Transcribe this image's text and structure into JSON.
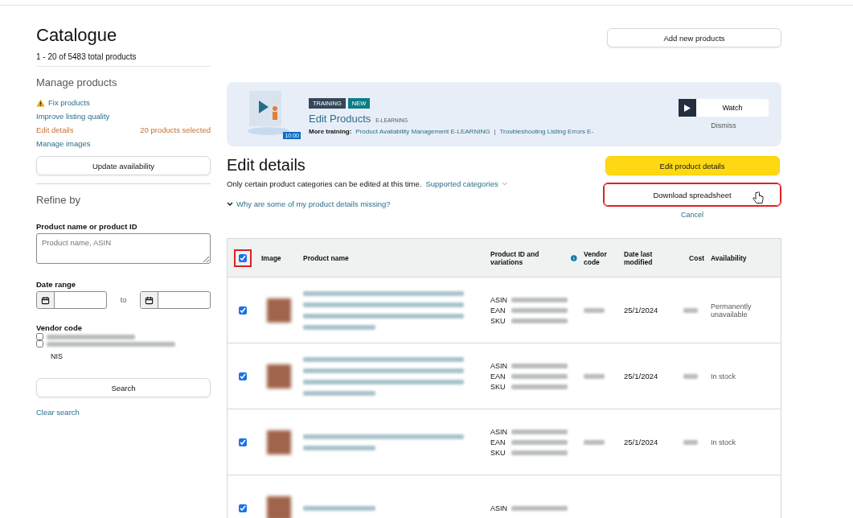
{
  "header": {
    "title": "Catalogue",
    "count": "1 - 20 of 5483 total products",
    "add_button": "Add new products"
  },
  "sidebar": {
    "manage_title": "Manage products",
    "links": [
      {
        "label": "Fix products",
        "kind": "warning"
      },
      {
        "label": "Improve listing quality",
        "kind": "link"
      },
      {
        "label": "Edit details",
        "kind": "active",
        "note": "20 products selected"
      },
      {
        "label": "Manage images",
        "kind": "link"
      }
    ],
    "update_button": "Update availability",
    "refine_title": "Refine by",
    "name_label": "Product name or product ID",
    "name_placeholder": "Product name, ASIN",
    "date_label": "Date range",
    "date_separator": "to",
    "vendor_label": "Vendor code",
    "vendors": [
      {
        "checked": false
      },
      {
        "checked": false,
        "suffix": "NIS"
      }
    ],
    "search_button": "Search",
    "clear_link": "Clear search"
  },
  "banner": {
    "tags": [
      "TRAINING",
      "NEW"
    ],
    "title": "Edit Products",
    "subtitle": "E-LEARNING",
    "duration": "10:00",
    "more_label": "More training:",
    "links": [
      "Product Availability Management E-LEARNING",
      "Troubleshooting Listing Errors E-"
    ],
    "link_separator": "|",
    "watch_button": "Watch",
    "dismiss": "Dismiss"
  },
  "edit": {
    "title": "Edit details",
    "note": "Only certain product categories can be edited at this time.",
    "categories_link": "Supported categories",
    "missing_link": "Why are some of my product details missing?",
    "primary_button": "Edit product details",
    "download_button": "Download spreadsheet",
    "download_highlighted": true,
    "cancel": "Cancel"
  },
  "table": {
    "select_all": {
      "checked": true,
      "highlighted": true
    },
    "columns": [
      "Image",
      "Product name",
      "Product ID and variations",
      "Vendor code",
      "Date last modified",
      "Cost",
      "Availability"
    ],
    "rows": [
      {
        "checked": true,
        "id_labels": [
          "ASIN",
          "EAN",
          "SKU"
        ],
        "date": "25/1/2024",
        "availability": "Permanently unavailable"
      },
      {
        "checked": true,
        "id_labels": [
          "ASIN",
          "EAN",
          "SKU"
        ],
        "date": "25/1/2024",
        "availability": "In stock"
      },
      {
        "checked": true,
        "id_labels": [
          "ASIN",
          "EAN",
          "SKU"
        ],
        "date": "25/1/2024",
        "availability": "In stock"
      },
      {
        "checked": true,
        "id_labels": [
          "ASIN"
        ]
      }
    ]
  }
}
